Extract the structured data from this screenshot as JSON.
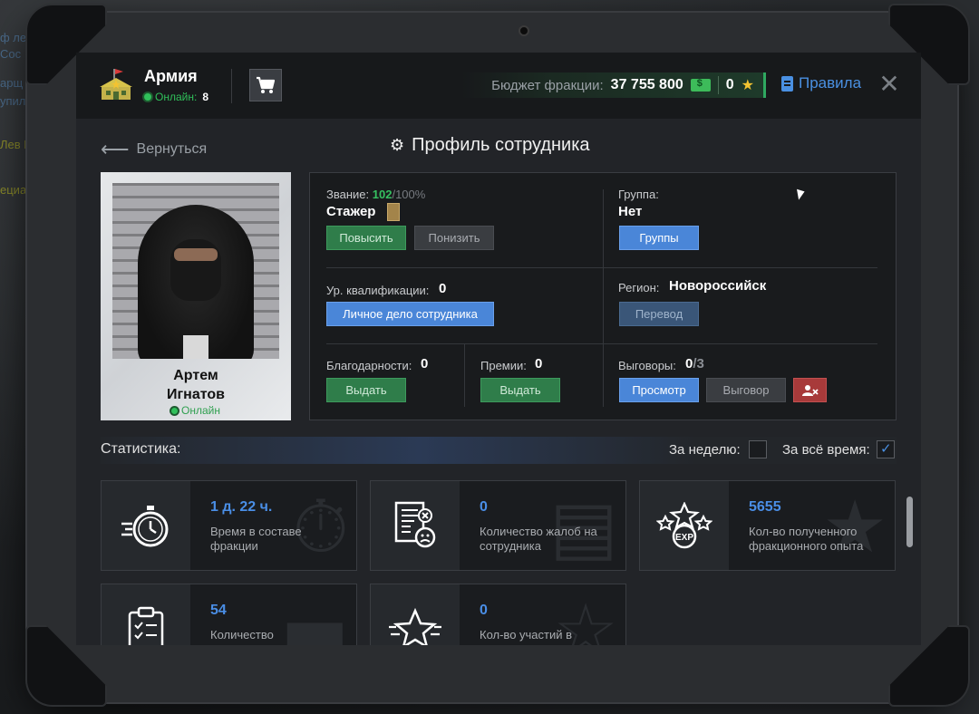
{
  "header": {
    "faction_name": "Армия",
    "online_label": "Онлайн:",
    "online_count": "8",
    "budget_label": "Бюджет фракции:",
    "budget_value": "37 755 800",
    "stars_value": "0",
    "rules_label": "Правила"
  },
  "nav": {
    "back_label": "Вернуться",
    "page_title": "Профиль сотрудника"
  },
  "employee": {
    "first_name": "Артем",
    "last_name": "Игнатов",
    "status": "Онлайн"
  },
  "profile": {
    "rank_label": "Звание:",
    "rank_progress": "102",
    "rank_progress_max": "/100%",
    "rank_name": "Стажер",
    "promote_label": "Повысить",
    "demote_label": "Понизить",
    "group_label": "Группа:",
    "group_value": "Нет",
    "groups_button": "Группы",
    "qualification_label": "Ур. квалификации:",
    "qualification_value": "0",
    "personal_file_button": "Личное дело сотрудника",
    "region_label": "Регион:",
    "region_value": "Новороссийск",
    "transfer_button": "Перевод",
    "thanks_label": "Благодарности:",
    "thanks_value": "0",
    "thanks_button": "Выдать",
    "bonus_label": "Премии:",
    "bonus_value": "0",
    "bonus_button": "Выдать",
    "reprimand_label": "Выговоры:",
    "reprimand_value": "0",
    "reprimand_max": "/3",
    "view_button": "Просмотр",
    "reprimand_button": "Выговор"
  },
  "stats": {
    "title": "Статистика:",
    "week_label": "За неделю:",
    "all_time_label": "За всё время:",
    "week_checked": false,
    "all_time_checked": true,
    "cards": [
      {
        "icon": "stopwatch-icon",
        "value": "1 д. 22 ч.",
        "desc": "Время в составе фракции"
      },
      {
        "icon": "complaint-report-icon",
        "value": "0",
        "desc": "Количество жалоб на сотрудника"
      },
      {
        "icon": "exp-stars-icon",
        "value": "5655",
        "desc": "Кол-во полученного фракционного опыта"
      },
      {
        "icon": "clipboard-checklist-icon",
        "value": "54",
        "desc": "Количество"
      },
      {
        "icon": "star-events-icon",
        "value": "0",
        "desc": "Кол-во участий в"
      }
    ]
  },
  "colors": {
    "accent_blue": "#4a8ee6",
    "online_green": "#30c05a",
    "button_green": "#2f7d4a",
    "button_blue": "#4a86d8",
    "button_red": "#a83a3a"
  }
}
